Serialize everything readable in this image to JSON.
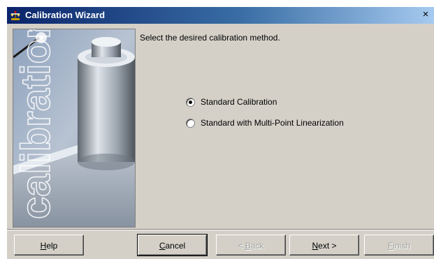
{
  "window": {
    "title": "Calibration Wizard",
    "close_glyph": "×",
    "title_icon": "scale-icon"
  },
  "side_image": {
    "text": "calibration"
  },
  "content": {
    "instruction": "Select the desired calibration method.",
    "options": [
      {
        "label": "Standard Calibration",
        "selected": true
      },
      {
        "label": "Standard with Multi-Point Linearization",
        "selected": false
      }
    ]
  },
  "buttons": {
    "help": {
      "mnemonic": "H",
      "rest": "elp"
    },
    "cancel": {
      "mnemonic": "C",
      "rest": "ancel"
    },
    "back": {
      "prefix": "< ",
      "mnemonic": "B",
      "rest": "ack",
      "enabled": false
    },
    "next": {
      "mnemonic": "N",
      "rest": "ext >"
    },
    "finish": {
      "mnemonic": "F",
      "rest": "inish",
      "enabled": false
    }
  },
  "colors": {
    "titlebar_start": "#0a246a",
    "titlebar_end": "#a6caf0",
    "dialog_bg": "#d4d0c8"
  }
}
